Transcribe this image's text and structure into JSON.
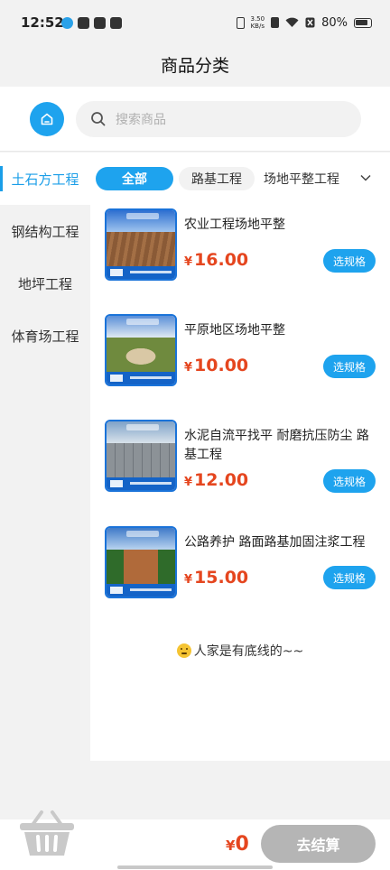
{
  "status_bar": {
    "time": "12:52",
    "speed_value": "3.50",
    "speed_unit": "KB/s",
    "battery": "80%"
  },
  "header": {
    "title": "商品分类"
  },
  "search": {
    "placeholder": "搜索商品"
  },
  "left_categories": [
    {
      "label": "土石方工程",
      "active": true
    },
    {
      "label": "钢结构工程",
      "active": false
    },
    {
      "label": "地坪工程",
      "active": false
    },
    {
      "label": "体育场工程",
      "active": false
    }
  ],
  "sub_tabs": [
    {
      "label": "全部",
      "active": true
    },
    {
      "label": "路基工程",
      "active": false
    },
    {
      "label": "场地平整工程",
      "active": false
    }
  ],
  "products": [
    {
      "name": "农业工程场地平整",
      "price": "16.00",
      "button": "选规格"
    },
    {
      "name": "平原地区场地平整",
      "price": "10.00",
      "button": "选规格"
    },
    {
      "name": "水泥自流平找平 耐磨抗压防尘 路基工程",
      "price": "12.00",
      "button": "选规格"
    },
    {
      "name": "公路养护 路面路基加固注浆工程",
      "price": "15.00",
      "button": "选规格"
    }
  ],
  "currency_symbol": "¥",
  "end_note": "人家是有底线的~~",
  "cart": {
    "total": "0",
    "checkout_label": "去结算"
  },
  "colors": {
    "accent": "#1ea3ee",
    "price": "#e5461f",
    "checkout_disabled": "#b5b5b5"
  },
  "icons": [
    "home-icon",
    "search-icon",
    "chevron-down-icon",
    "shopping-basket-icon",
    "sad-face-icon"
  ]
}
